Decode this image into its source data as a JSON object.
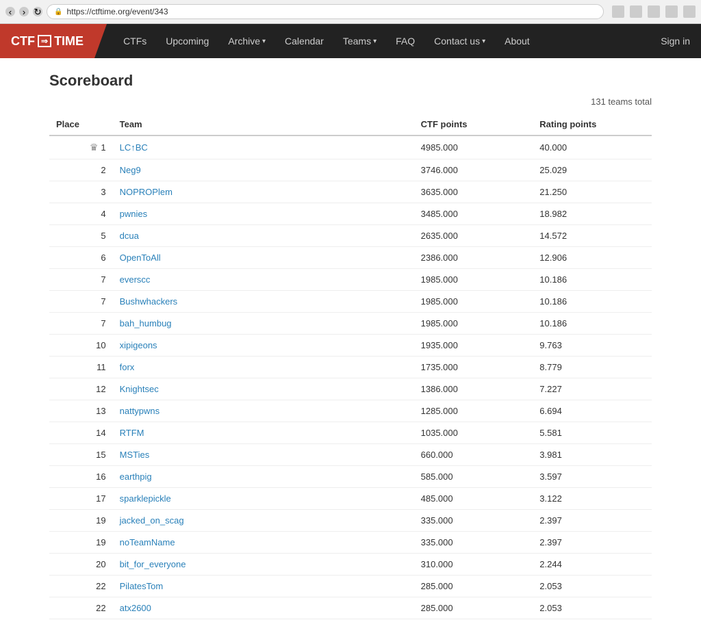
{
  "browser": {
    "url": "https://ctftime.org/event/343",
    "back_disabled": true,
    "forward_disabled": true
  },
  "navbar": {
    "logo": "CTF ⇒ TIME",
    "logo_ctf": "CTF",
    "logo_arrow": "⇒",
    "logo_time": "TIME",
    "links": [
      {
        "label": "CTFs",
        "dropdown": false
      },
      {
        "label": "Upcoming",
        "dropdown": false
      },
      {
        "label": "Archive",
        "dropdown": true
      },
      {
        "label": "Calendar",
        "dropdown": false
      },
      {
        "label": "Teams",
        "dropdown": true
      },
      {
        "label": "FAQ",
        "dropdown": false
      },
      {
        "label": "Contact us",
        "dropdown": true
      },
      {
        "label": "About",
        "dropdown": false
      }
    ],
    "sign_in": "Sign in"
  },
  "page": {
    "title": "Scoreboard",
    "teams_total": "131 teams total"
  },
  "table": {
    "headers": [
      "Place",
      "Team",
      "CTF points",
      "Rating points"
    ],
    "rows": [
      {
        "place": "1",
        "crown": true,
        "team": "LC↑BC",
        "ctf_points": "4985.000",
        "rating_points": "40.000"
      },
      {
        "place": "2",
        "crown": false,
        "team": "Neg9",
        "ctf_points": "3746.000",
        "rating_points": "25.029"
      },
      {
        "place": "3",
        "crown": false,
        "team": "NOPROPlem",
        "ctf_points": "3635.000",
        "rating_points": "21.250"
      },
      {
        "place": "4",
        "crown": false,
        "team": "pwnies",
        "ctf_points": "3485.000",
        "rating_points": "18.982"
      },
      {
        "place": "5",
        "crown": false,
        "team": "dcua",
        "ctf_points": "2635.000",
        "rating_points": "14.572"
      },
      {
        "place": "6",
        "crown": false,
        "team": "OpenToAll",
        "ctf_points": "2386.000",
        "rating_points": "12.906"
      },
      {
        "place": "7",
        "crown": false,
        "team": "everscc",
        "ctf_points": "1985.000",
        "rating_points": "10.186"
      },
      {
        "place": "7",
        "crown": false,
        "team": "Bushwhackers",
        "ctf_points": "1985.000",
        "rating_points": "10.186"
      },
      {
        "place": "7",
        "crown": false,
        "team": "bah_humbug",
        "ctf_points": "1985.000",
        "rating_points": "10.186"
      },
      {
        "place": "10",
        "crown": false,
        "team": "xipigeons",
        "ctf_points": "1935.000",
        "rating_points": "9.763"
      },
      {
        "place": "11",
        "crown": false,
        "team": "forx",
        "ctf_points": "1735.000",
        "rating_points": "8.779"
      },
      {
        "place": "12",
        "crown": false,
        "team": "Knightsec",
        "ctf_points": "1386.000",
        "rating_points": "7.227"
      },
      {
        "place": "13",
        "crown": false,
        "team": "nattypwns",
        "ctf_points": "1285.000",
        "rating_points": "6.694"
      },
      {
        "place": "14",
        "crown": false,
        "team": "RTFM",
        "ctf_points": "1035.000",
        "rating_points": "5.581"
      },
      {
        "place": "15",
        "crown": false,
        "team": "MSTies",
        "ctf_points": "660.000",
        "rating_points": "3.981"
      },
      {
        "place": "16",
        "crown": false,
        "team": "earthpig",
        "ctf_points": "585.000",
        "rating_points": "3.597"
      },
      {
        "place": "17",
        "crown": false,
        "team": "sparklepickle",
        "ctf_points": "485.000",
        "rating_points": "3.122"
      },
      {
        "place": "19",
        "crown": false,
        "team": "jacked_on_scag",
        "ctf_points": "335.000",
        "rating_points": "2.397"
      },
      {
        "place": "19",
        "crown": false,
        "team": "noTeamName",
        "ctf_points": "335.000",
        "rating_points": "2.397"
      },
      {
        "place": "20",
        "crown": false,
        "team": "bit_for_everyone",
        "ctf_points": "310.000",
        "rating_points": "2.244"
      },
      {
        "place": "22",
        "crown": false,
        "team": "PilatesTom",
        "ctf_points": "285.000",
        "rating_points": "2.053"
      },
      {
        "place": "22",
        "crown": false,
        "team": "atx2600",
        "ctf_points": "285.000",
        "rating_points": "2.053"
      }
    ]
  }
}
